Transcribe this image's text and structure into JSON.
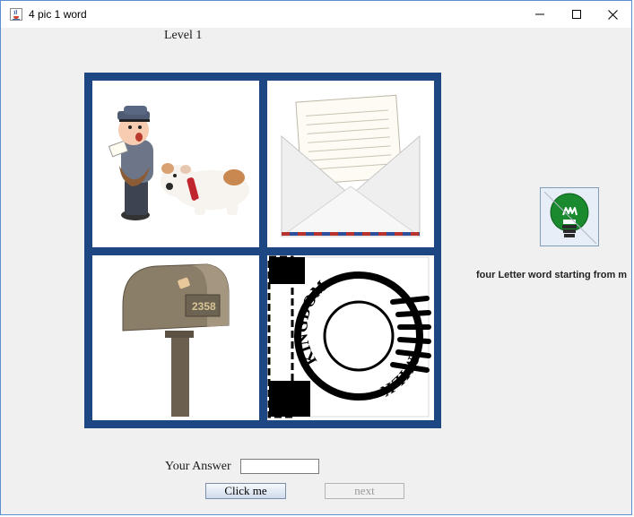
{
  "window": {
    "title": "4 pic 1 word"
  },
  "game": {
    "level": "Level 1",
    "hint_text": "four Letter word starting from m",
    "answer_label": "Your Answer",
    "answer_value": "",
    "click_label": "Click me",
    "next_label": "next",
    "pictures": {
      "stamp_text_top": "KINGDOM",
      "stamp_text_bottom": "MILK",
      "mailbox_number": "2358"
    }
  },
  "icons": {
    "app": "java-coffee-icon",
    "hint": "lightbulb-icon",
    "minimize": "minimize-icon",
    "maximize": "maximize-icon",
    "close": "close-icon"
  },
  "colors": {
    "grid_border": "#1c4782",
    "bulb_green": "#1b8a2f"
  }
}
